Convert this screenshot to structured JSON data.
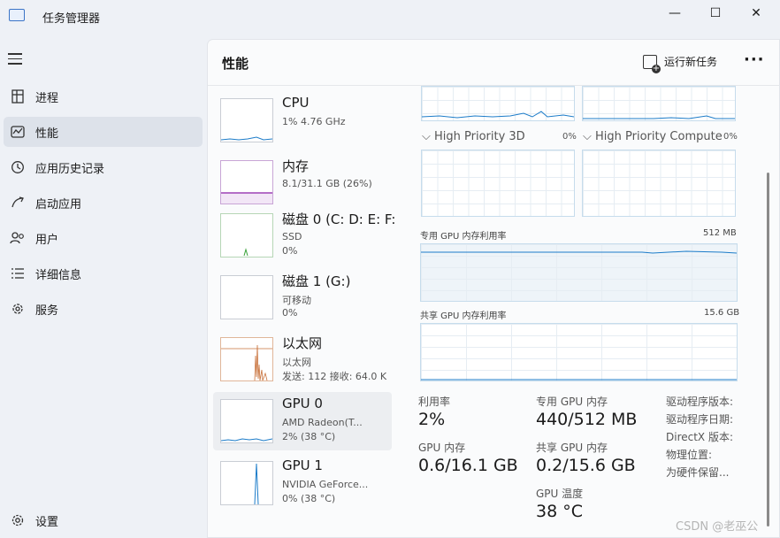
{
  "window": {
    "title": "任务管理器",
    "minimize": "—",
    "maximize": "☐",
    "close": "✕"
  },
  "sidebar": {
    "items": [
      {
        "label": "进程",
        "icon": "processes-icon"
      },
      {
        "label": "性能",
        "icon": "performance-icon"
      },
      {
        "label": "应用历史记录",
        "icon": "history-icon"
      },
      {
        "label": "启动应用",
        "icon": "startup-icon"
      },
      {
        "label": "用户",
        "icon": "users-icon"
      },
      {
        "label": "详细信息",
        "icon": "details-icon"
      },
      {
        "label": "服务",
        "icon": "services-icon"
      }
    ],
    "settings_label": "设置"
  },
  "header": {
    "title": "性能",
    "run_new_task": "运行新任务",
    "more": "···"
  },
  "devices": [
    {
      "name": "CPU",
      "line1": "1% 4.76 GHz",
      "line2": ""
    },
    {
      "name": "内存",
      "line1": "8.1/31.1 GB (26%)",
      "line2": ""
    },
    {
      "name": "磁盘 0 (C: D: E: F:",
      "line1": "SSD",
      "line2": "0%"
    },
    {
      "name": "磁盘 1 (G:)",
      "line1": "可移动",
      "line2": "0%"
    },
    {
      "name": "以太网",
      "line1": "以太网",
      "line2": "发送: 112 接收: 64.0 K"
    },
    {
      "name": "GPU 0",
      "line1": "AMD Radeon(T...",
      "line2": "2% (38 °C)"
    },
    {
      "name": "GPU 1",
      "line1": "NVIDIA GeForce...",
      "line2": "0% (38 °C)"
    }
  ],
  "engines": [
    {
      "label": "High Priority 3D",
      "pct": "0%"
    },
    {
      "label": "High Priority Compute",
      "pct": "0%"
    }
  ],
  "dedicated_graph": {
    "label": "专用 GPU 内存利用率",
    "max": "512 MB"
  },
  "shared_graph": {
    "label": "共享 GPU 内存利用率",
    "max": "15.6 GB"
  },
  "stats": {
    "utilization_label": "利用率",
    "utilization": "2%",
    "dedicated_label": "专用 GPU 内存",
    "dedicated": "440/512 MB",
    "gpu_mem_label": "GPU 内存",
    "gpu_mem": "0.6/16.1 GB",
    "shared_label": "共享 GPU 内存",
    "shared": "0.2/15.6 GB",
    "temp_label": "GPU 温度",
    "temp": "38 °C"
  },
  "info": [
    "驱动程序版本:",
    "驱动程序日期:",
    "DirectX 版本:",
    "物理位置:",
    "为硬件保留..."
  ],
  "watermark": "CSDN @老巫公",
  "colors": {
    "cpu": "#1c7cc9",
    "memory": "#8b1fa8",
    "disk": "#3aa33a",
    "ethernet": "#c8713a",
    "gpu": "#1c7cc9"
  }
}
